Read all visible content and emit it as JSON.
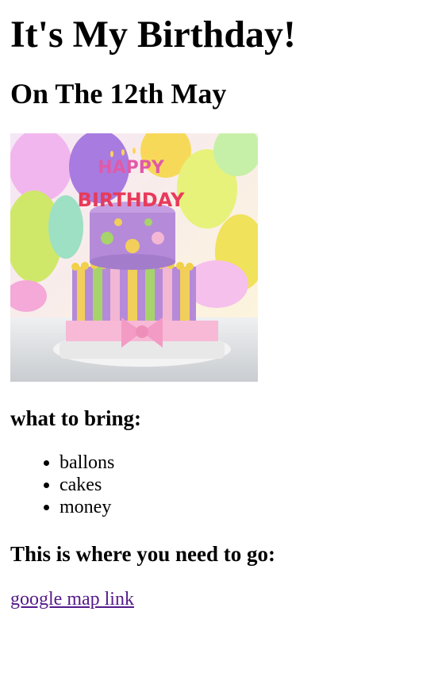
{
  "header": {
    "title": "It's My Birthday!",
    "date_heading": "On The 12th May"
  },
  "image": {
    "icon": "birthday-cake-image",
    "cake_topper_line1": "HAPPY",
    "cake_topper_line2": "BIRTHDAY"
  },
  "bring": {
    "heading": "what to bring:",
    "items": [
      "ballons",
      "cakes",
      "money"
    ]
  },
  "location": {
    "heading": "This is where you need to go:",
    "link_text": "google map link"
  },
  "colors": {
    "text": "#000000",
    "visited_link": "#551a8b",
    "background": "#ffffff"
  }
}
